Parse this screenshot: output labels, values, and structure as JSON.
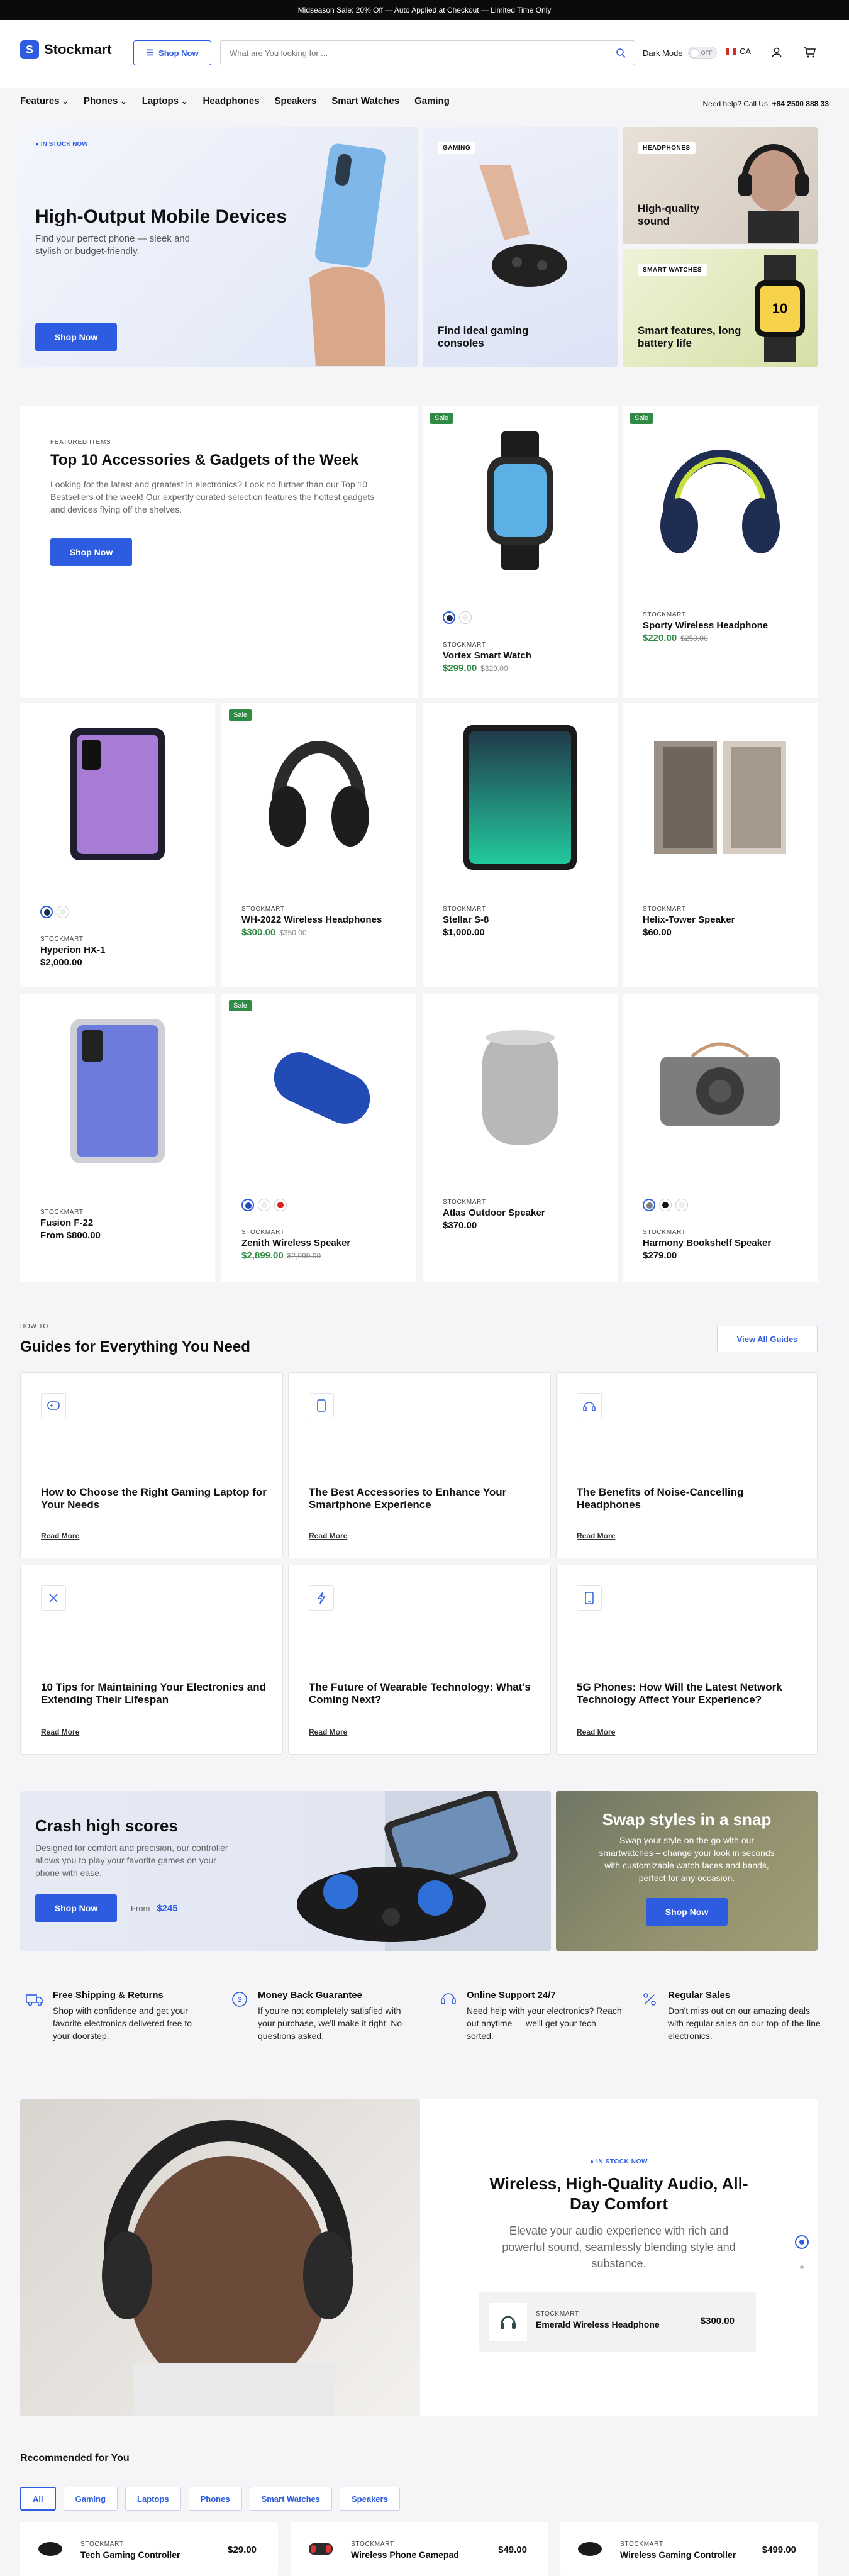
{
  "announcement": "Midseason Sale: 20% Off — Auto Applied at Checkout — Limited Time Only",
  "header": {
    "logo": "Stockmart",
    "shop_now": "Shop Now",
    "search_placeholder": "What are You looking for ...",
    "dark_mode_label": "Dark Mode",
    "dark_mode_state": "OFF",
    "country": "CA",
    "icons": [
      "menu-icon",
      "search-icon",
      "user-icon",
      "cart-icon"
    ]
  },
  "nav": {
    "items": [
      {
        "label": "Features",
        "dropdown": true
      },
      {
        "label": "Phones",
        "dropdown": true
      },
      {
        "label": "Laptops",
        "dropdown": true
      },
      {
        "label": "Headphones",
        "dropdown": false
      },
      {
        "label": "Speakers",
        "dropdown": false
      },
      {
        "label": "Smart Watches",
        "dropdown": false
      },
      {
        "label": "Gaming",
        "dropdown": false
      }
    ],
    "help_label": "Need help? Call Us:",
    "help_phone": "+84 2500 888 33"
  },
  "hero": {
    "main": {
      "badge": "IN STOCK NOW",
      "title": "High-Output Mobile Devices",
      "text": "Find your perfect phone — sleek and stylish or budget-friendly.",
      "button": "Shop Now"
    },
    "gaming": {
      "tag": "GAMING",
      "title": "Find ideal gaming consoles"
    },
    "headphones": {
      "tag": "HEADPHONES",
      "title": "High-quality sound"
    },
    "watches": {
      "tag": "SMART WATCHES",
      "title": "Smart features, long battery life"
    }
  },
  "featured": {
    "eyebrow": "FEATURED ITEMS",
    "title": "Top 10 Accessories & Gadgets of the Week",
    "text": "Looking for the latest and greatest in electronics? Look no further than our Top 10 Bestsellers of the week! Our expertly curated selection features the hottest gadgets and devices flying off the shelves.",
    "button": "Shop Now"
  },
  "products": [
    {
      "brand": "STOCKMART",
      "name": "Vortex Smart Watch",
      "price": "$299.00",
      "old": "$329.00",
      "sale": "Sale"
    },
    {
      "brand": "STOCKMART",
      "name": "Sporty Wireless Headphone",
      "price": "$220.00",
      "old": "$250.00",
      "sale": "Sale"
    },
    {
      "brand": "STOCKMART",
      "name": "Hyperion HX-1",
      "price": "$2,000.00",
      "old": "",
      "sale": ""
    },
    {
      "brand": "STOCKMART",
      "name": "WH-2022 Wireless Headphones",
      "price": "$300.00",
      "old": "$350.00",
      "sale": "Sale"
    },
    {
      "brand": "STOCKMART",
      "name": "Stellar S-8",
      "price": "$1,000.00",
      "old": "",
      "sale": ""
    },
    {
      "brand": "STOCKMART",
      "name": "Helix-Tower Speaker",
      "price": "$60.00",
      "old": "",
      "sale": ""
    },
    {
      "brand": "STOCKMART",
      "name": "Fusion F-22",
      "price": "From $800.00",
      "old": "",
      "sale": ""
    },
    {
      "brand": "STOCKMART",
      "name": "Zenith Wireless Speaker",
      "price": "$2,899.00",
      "old": "$2,999.00",
      "sale": "Sale"
    },
    {
      "brand": "STOCKMART",
      "name": "Atlas Outdoor Speaker",
      "price": "$370.00",
      "old": "",
      "sale": ""
    },
    {
      "brand": "STOCKMART",
      "name": "Harmony Bookshelf Speaker",
      "price": "$279.00",
      "old": "",
      "sale": ""
    }
  ],
  "guides": {
    "eyebrow": "HOW TO",
    "title": "Guides for Everything You Need",
    "view_all": "View All Guides",
    "read_more": "Read More",
    "items": [
      {
        "title": "How to Choose the Right Gaming Laptop for Your Needs",
        "icon": "gamepad-icon"
      },
      {
        "title": "The Best Accessories to Enhance Your Smartphone Experience",
        "icon": "smartphone-icon"
      },
      {
        "title": "The Benefits of Noise-Cancelling Headphones",
        "icon": "headphones-icon"
      },
      {
        "title": "10 Tips for Maintaining Your Electronics and Extending Their Lifespan",
        "icon": "tools-icon"
      },
      {
        "title": "The Future of Wearable Technology: What's Coming Next?",
        "icon": "lightning-icon"
      },
      {
        "title": "5G Phones: How Will the Latest Network Technology Affect Your Experience?",
        "icon": "phone-icon"
      }
    ]
  },
  "promo": {
    "left": {
      "title": "Crash high scores",
      "text": "Designed for comfort and precision, our controller allows you to play your favorite games on your phone with ease.",
      "button": "Shop Now",
      "from_label": "From",
      "from_price": "$245"
    },
    "right": {
      "title": "Swap styles in a snap",
      "text": "Swap your style on the go with our smartwatches – change your look in seconds with customizable watch faces and bands, perfect for any occasion.",
      "button": "Shop Now"
    }
  },
  "features": [
    {
      "title": "Free Shipping & Returns",
      "text": "Shop with confidence and get your favorite electronics delivered free to your doorstep.",
      "icon": "truck-icon"
    },
    {
      "title": "Money Back Guarantee",
      "text": "If you're not completely satisfied with your purchase, we'll make it right. No questions asked.",
      "icon": "money-back-icon"
    },
    {
      "title": "Online Support 24/7",
      "text": "Need help with your electronics? Reach out anytime — we'll get your tech sorted.",
      "icon": "support-icon"
    },
    {
      "title": "Regular Sales",
      "text": "Don't miss out on our amazing deals with regular sales on our top-of-the-line electronics.",
      "icon": "percent-icon"
    }
  ],
  "audio": {
    "badge": "IN STOCK NOW",
    "title": "Wireless, High-Quality Audio, All-Day Comfort",
    "text": "Elevate your audio experience with rich and powerful sound, seamlessly blending style and substance.",
    "product_brand": "STOCKMART",
    "product_name": "Emerald Wireless Headphone",
    "product_price": "$300.00"
  },
  "recommended": {
    "title": "Recommended for You",
    "tabs": [
      "All",
      "Gaming",
      "Laptops",
      "Phones",
      "Smart Watches",
      "Speakers"
    ],
    "items": [
      {
        "brand": "STOCKMART",
        "name": "Tech Gaming Controller",
        "price": "$29.00"
      },
      {
        "brand": "STOCKMART",
        "name": "Wireless Phone Gamepad",
        "price": "$49.00"
      },
      {
        "brand": "STOCKMART",
        "name": "Wireless Gaming Controller",
        "price": "$499.00"
      }
    ]
  },
  "colors": {
    "accent": "#2e5ce0",
    "sale": "#2f8b43"
  }
}
